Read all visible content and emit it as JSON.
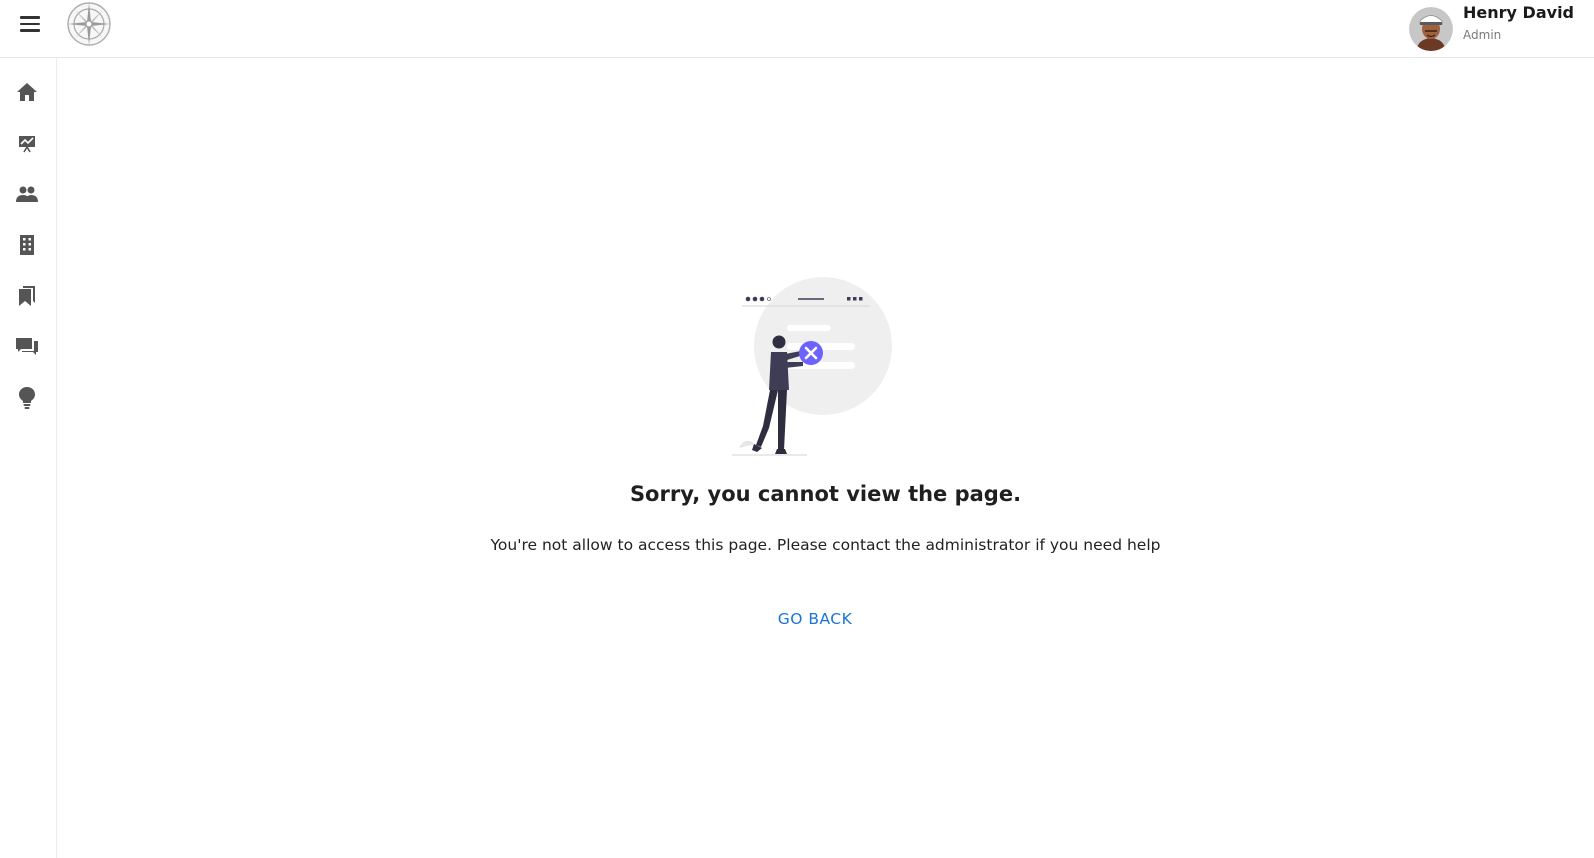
{
  "header": {
    "menu_icon": "hamburger-menu-icon",
    "logo": "compass-logo",
    "user": {
      "name": "Henry David",
      "role": "Admin"
    }
  },
  "sidebar": {
    "items": [
      {
        "icon": "home-icon"
      },
      {
        "icon": "presentation-chart-icon"
      },
      {
        "icon": "people-icon"
      },
      {
        "icon": "building-icon"
      },
      {
        "icon": "bookmarks-icon"
      },
      {
        "icon": "chat-icon"
      },
      {
        "icon": "lightbulb-icon"
      }
    ]
  },
  "main": {
    "title": "Sorry, you cannot view the page.",
    "description": "You're not allow to access this page. Please contact the administrator if you need help",
    "go_back_label": "GO BACK"
  },
  "colors": {
    "link": "#1976d2",
    "accent_purple": "#6c63ff",
    "icon_gray": "#555555"
  }
}
